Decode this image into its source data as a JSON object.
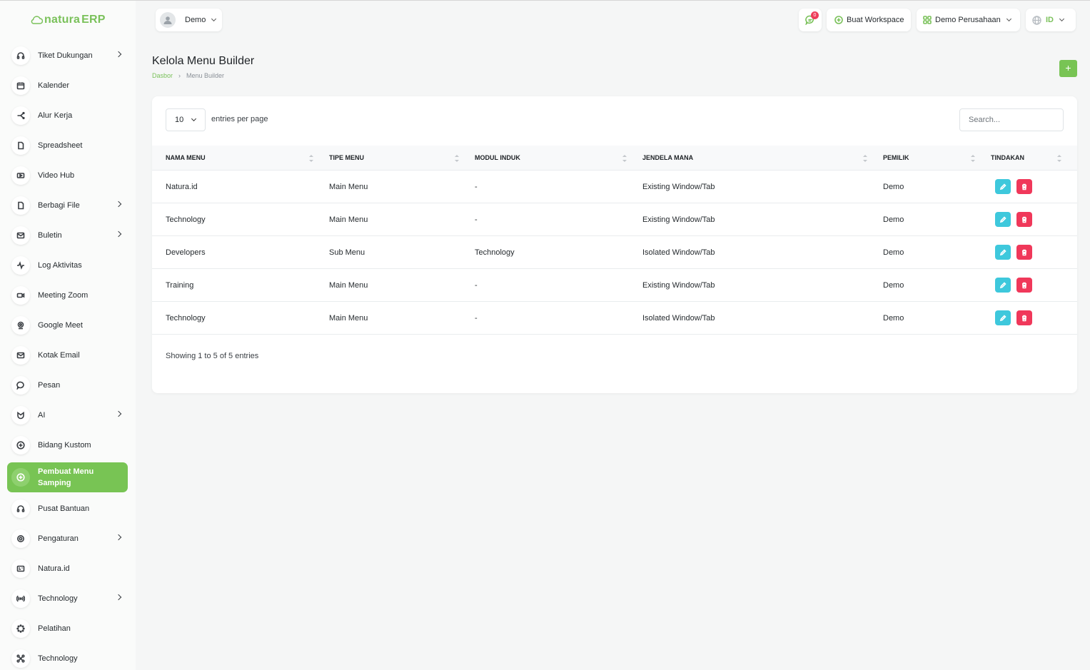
{
  "app": {
    "logo_text": "natura",
    "logo_suffix": "ERP",
    "accent_color": "#78c454"
  },
  "sidebar": {
    "items": [
      {
        "label": "Tiket Dukungan",
        "icon": "headset-icon",
        "has_children": true
      },
      {
        "label": "Kalender",
        "icon": "calendar-icon",
        "has_children": false
      },
      {
        "label": "Alur Kerja",
        "icon": "workflow-icon",
        "has_children": false
      },
      {
        "label": "Spreadsheet",
        "icon": "file-icon",
        "has_children": false
      },
      {
        "label": "Video Hub",
        "icon": "video-icon",
        "has_children": false
      },
      {
        "label": "Berbagi File",
        "icon": "file-icon",
        "has_children": true
      },
      {
        "label": "Buletin",
        "icon": "mail-icon",
        "has_children": true
      },
      {
        "label": "Log Aktivitas",
        "icon": "activity-icon",
        "has_children": false
      },
      {
        "label": "Meeting Zoom",
        "icon": "camera-icon",
        "has_children": false
      },
      {
        "label": "Google Meet",
        "icon": "meet-icon",
        "has_children": false
      },
      {
        "label": "Kotak Email",
        "icon": "mail-icon",
        "has_children": false
      },
      {
        "label": "Pesan",
        "icon": "chat-icon",
        "has_children": false
      },
      {
        "label": "AI",
        "icon": "ai-icon",
        "has_children": true
      },
      {
        "label": "Bidang Kustom",
        "icon": "plus-circle-icon",
        "has_children": false
      },
      {
        "label": "Pembuat Menu Samping",
        "icon": "plus-circle-icon",
        "has_children": false,
        "active": true
      },
      {
        "label": "Pusat Bantuan",
        "icon": "headset-icon",
        "has_children": false
      },
      {
        "label": "Pengaturan",
        "icon": "gear-icon",
        "has_children": true
      },
      {
        "label": "Natura.id",
        "icon": "id-card-icon",
        "has_children": false
      },
      {
        "label": "Technology",
        "icon": "broadcast-icon",
        "has_children": true
      },
      {
        "label": "Pelatihan",
        "icon": "dots-circle-icon",
        "has_children": false
      },
      {
        "label": "Technology",
        "icon": "network-icon",
        "has_children": false
      }
    ]
  },
  "topbar": {
    "user_name": "Demo",
    "notification_count": "0",
    "workspace_button": "Buat Workspace",
    "company_selector": "Demo Perusahaan",
    "language": "ID"
  },
  "page": {
    "title": "Kelola Menu Builder",
    "breadcrumb_home": "Dasbor",
    "breadcrumb_current": "Menu Builder",
    "add_label": "+"
  },
  "table": {
    "per_page_value": "10",
    "per_page_label": "entries per page",
    "search_placeholder": "Search...",
    "columns": [
      "Nama Menu",
      "Tipe Menu",
      "Modul Induk",
      "Jendela Mana",
      "Pemilik",
      "Tindakan"
    ],
    "rows": [
      {
        "nama": "Natura.id",
        "tipe": "Main Menu",
        "modul": "-",
        "jendela": "Existing Window/Tab",
        "pemilik": "Demo"
      },
      {
        "nama": "Technology",
        "tipe": "Main Menu",
        "modul": "-",
        "jendela": "Existing Window/Tab",
        "pemilik": "Demo"
      },
      {
        "nama": "Developers",
        "tipe": "Sub Menu",
        "modul": "Technology",
        "jendela": "Isolated Window/Tab",
        "pemilik": "Demo"
      },
      {
        "nama": "Training",
        "tipe": "Main Menu",
        "modul": "-",
        "jendela": "Existing Window/Tab",
        "pemilik": "Demo"
      },
      {
        "nama": "Technology",
        "tipe": "Main Menu",
        "modul": "-",
        "jendela": "Isolated Window/Tab",
        "pemilik": "Demo"
      }
    ],
    "showing_text": "Showing 1 to 5 of 5 entries"
  }
}
